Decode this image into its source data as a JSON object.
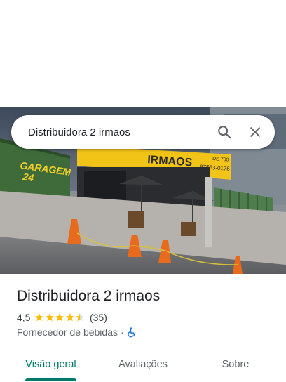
{
  "search": {
    "query": "Distribuidora 2 irmaos",
    "search_icon": "search-icon",
    "close_icon": "close-icon"
  },
  "photo": {
    "sign_left_line1": "GARAGEM",
    "sign_left_line2": "24",
    "sign_main": "IRMAOS",
    "sign_right": "DE 700",
    "sign_phone": "97553-0176"
  },
  "place": {
    "name": "Distribuidora 2 irmaos",
    "rating": "4,5",
    "stars": 4.5,
    "reviews": "(35)",
    "category": "Fornecedor de bebidas",
    "separator": "·",
    "accessibility_icon": "wheelchair-icon"
  },
  "tabs": [
    {
      "label": "Visão geral",
      "active": true
    },
    {
      "label": "Avaliações",
      "active": false
    },
    {
      "label": "Sobre",
      "active": false
    }
  ],
  "colors": {
    "accent": "#00796b",
    "star": "#fbbc04",
    "accessibility": "#1a73e8"
  }
}
